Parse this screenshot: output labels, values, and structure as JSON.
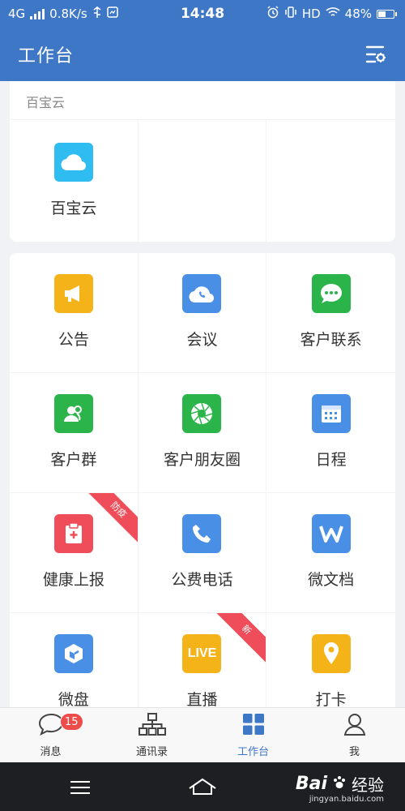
{
  "status_bar": {
    "network": "4G",
    "speed": "0.8K/s",
    "time": "14:48",
    "hd": "HD",
    "battery": "48%",
    "battery_level": 0.48
  },
  "header": {
    "title": "工作台",
    "filter_icon": "settings-filter-icon"
  },
  "section1": {
    "title": "百宝云",
    "items": [
      {
        "label": "百宝云",
        "icon": "cloud-icon",
        "color": "#2fbcf0"
      }
    ]
  },
  "apps": [
    {
      "label": "公告",
      "icon": "megaphone-icon",
      "color": "#f5b31a"
    },
    {
      "label": "会议",
      "icon": "meeting-cloud-phone-icon",
      "color": "#4a8fe6"
    },
    {
      "label": "客户联系",
      "icon": "chat-bubble-icon",
      "color": "#2bb44a"
    },
    {
      "label": "客户群",
      "icon": "group-icon",
      "color": "#2bb44a"
    },
    {
      "label": "客户朋友圈",
      "icon": "aperture-icon",
      "color": "#2bb44a"
    },
    {
      "label": "日程",
      "icon": "calendar-icon",
      "color": "#4a8fe6"
    },
    {
      "label": "健康上报",
      "icon": "health-report-icon",
      "color": "#f04d5a",
      "ribbon": "防疫"
    },
    {
      "label": "公费电话",
      "icon": "phone-icon",
      "color": "#4a8fe6"
    },
    {
      "label": "微文档",
      "icon": "document-w-icon",
      "color": "#4a8fe6"
    },
    {
      "label": "微盘",
      "icon": "drive-icon",
      "color": "#4a8fe6"
    },
    {
      "label": "直播",
      "icon": "live-icon",
      "color": "#f5b31a",
      "ribbon": "新",
      "badge_text": "LIVE"
    },
    {
      "label": "打卡",
      "icon": "location-pin-icon",
      "color": "#f5b31a"
    }
  ],
  "tabbar": {
    "tabs": [
      {
        "label": "消息",
        "icon": "chat-bubble-outline-icon",
        "badge": "15"
      },
      {
        "label": "通讯录",
        "icon": "org-chart-icon"
      },
      {
        "label": "工作台",
        "icon": "grid-icon",
        "active": true
      },
      {
        "label": "我",
        "icon": "person-icon"
      }
    ],
    "accent": "#3f77c7"
  },
  "watermark": {
    "brand": "Bai",
    "brand2": "经验",
    "url": "jingyan.baidu.com"
  }
}
